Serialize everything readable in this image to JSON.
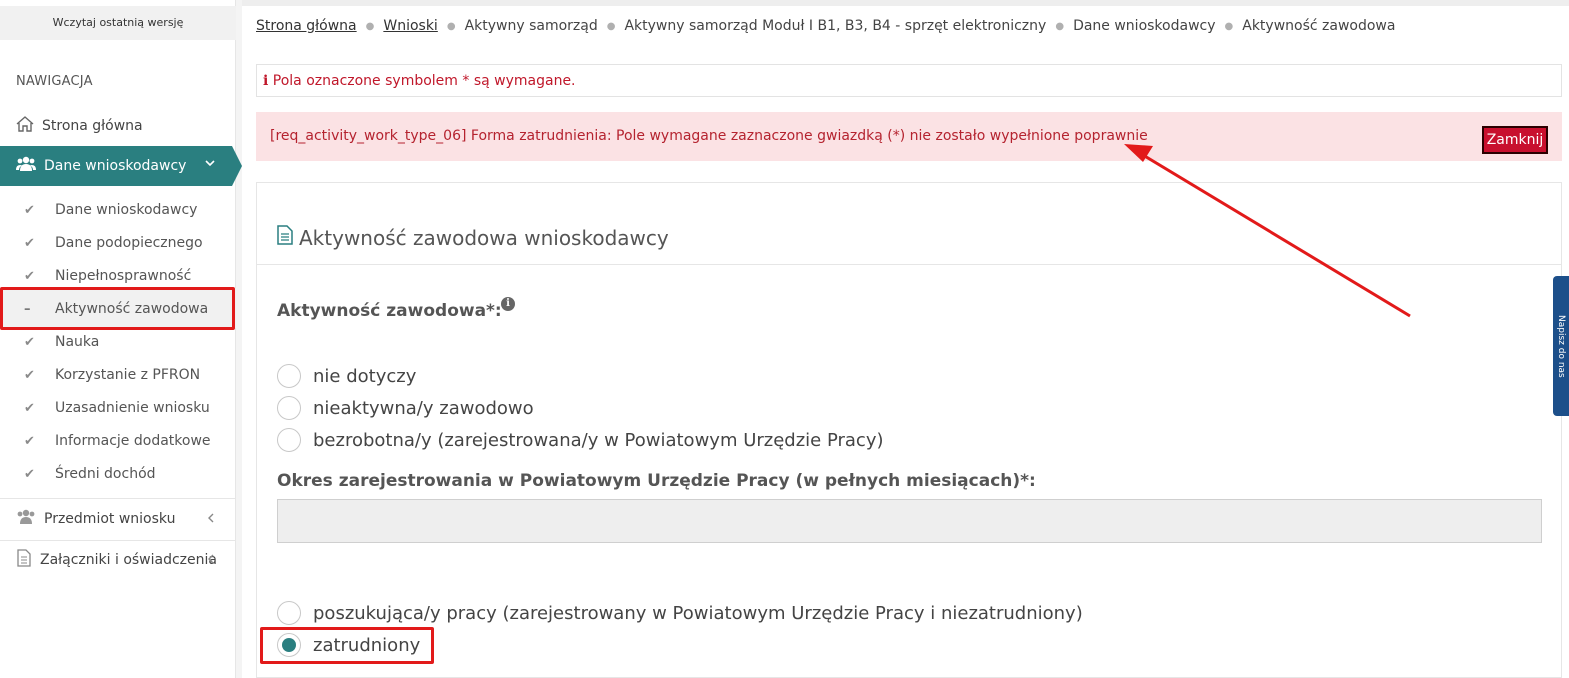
{
  "sidebar": {
    "load_button": "Wczytaj ostatnią wersję",
    "nav_heading": "NAWIGACJA",
    "home": "Strona główna",
    "active_section": "Dane wnioskodawcy",
    "sub_items": [
      "Dane wnioskodawcy",
      "Dane podopiecznego",
      "Niepełnosprawność",
      "Aktywność zawodowa",
      "Nauka",
      "Korzystanie z PFRON",
      "Uzasadnienie wniosku",
      "Informacje dodatkowe",
      "Średni dochód"
    ],
    "section_subject": "Przedmiot wniosku",
    "section_attachments": "Załączniki i oświadczenia"
  },
  "breadcrumb": [
    "Strona główna",
    "Wnioski",
    "Aktywny samorząd",
    "Aktywny samorząd Moduł I B1, B3, B4 - sprzęt elektroniczny",
    "Dane wnioskodawcy",
    "Aktywność zawodowa"
  ],
  "required_note": "Pola oznaczone symbolem * są wymagane.",
  "alert": {
    "message": "[req_activity_work_type_06] Forma zatrudnienia: Pole wymagane zaznaczone gwiazdką (*) nie zostało wypełnione poprawnie",
    "close_label": "Zamknij"
  },
  "panel": {
    "title": "Aktywność zawodowa wnioskodawcy",
    "activity_label": "Aktywność zawodowa*:",
    "options": [
      "nie dotyczy",
      "nieaktywna/y zawodowo",
      "bezrobotna/y (zarejestrowana/y w Powiatowym Urzędzie Pracy)"
    ],
    "period_label": "Okres zarejestrowania w Powiatowym Urzędzie Pracy (w pełnych miesiącach)*:",
    "period_value": "",
    "options_bottom": [
      "poszukująca/y pracy (zarejestrowany w Powiatowym Urzędzie Pracy i niezatrudniony)",
      "zatrudniony"
    ],
    "selected_option": "zatrudniony"
  },
  "side_tab": "Napisz do nas",
  "colors": {
    "teal": "#2a7f80",
    "alert_bg": "#fbe2e4",
    "alert_text": "#b5232f",
    "annotation_red": "#e21a1a"
  }
}
